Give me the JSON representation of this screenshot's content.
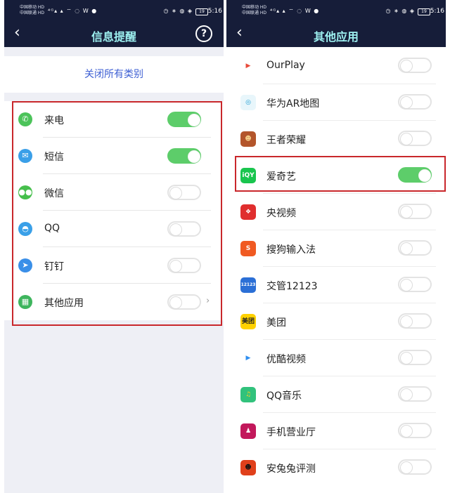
{
  "statusbar": {
    "carrier1": "中国移动 HD",
    "carrier2": "中国联通 HD",
    "left_icons": "⁴ᴳ▴ ▴ ⌔ ◌ W ●",
    "right_icons": "◷ ∗ ◍ ◈",
    "battery": "19",
    "time": "5:16"
  },
  "left": {
    "title": "信息提醒",
    "back_glyph": "‹",
    "help_glyph": "?",
    "close_all": "关闭所有类别",
    "chevron_glyph": "›",
    "categories": [
      {
        "label": "来电",
        "icon": "phone-icon",
        "glyph": "✆",
        "color": "#4cc35a",
        "on": true
      },
      {
        "label": "短信",
        "icon": "message-icon",
        "glyph": "✉",
        "color": "#3a9fe8",
        "on": true
      },
      {
        "label": "微信",
        "icon": "wechat-icon",
        "glyph": "●●",
        "color": "#46bf4c",
        "on": false
      },
      {
        "label": "QQ",
        "icon": "qq-icon",
        "glyph": "◓",
        "color": "#3aa0e8",
        "on": false
      },
      {
        "label": "钉钉",
        "icon": "dingtalk-icon",
        "glyph": "➤",
        "color": "#3a8fe8",
        "on": false
      },
      {
        "label": "其他应用",
        "icon": "apps-icon",
        "glyph": "▦",
        "color": "#3eb55d",
        "on": false,
        "has_chevron": true
      }
    ]
  },
  "right": {
    "title": "其他应用",
    "back_glyph": "‹",
    "apps": [
      {
        "label": "OurPlay",
        "icon": "ourplay-icon",
        "glyph": "▶",
        "color": "#ffffff",
        "fg": "#e84a3a",
        "on": false
      },
      {
        "label": "华为AR地图",
        "icon": "huawei-ar-map-icon",
        "glyph": "◎",
        "color": "#e8f6fb",
        "fg": "#1c9dd3",
        "on": false
      },
      {
        "label": "王者荣耀",
        "icon": "honor-of-kings-icon",
        "glyph": "☻",
        "color": "#b3552b",
        "fg": "#f5d08a",
        "on": false
      },
      {
        "label": "爱奇艺",
        "icon": "iqiyi-icon",
        "glyph": "iQY",
        "color": "#19c54e",
        "fg": "#ffffff",
        "on": true
      },
      {
        "label": "央视频",
        "icon": "cctv-video-icon",
        "glyph": "❖",
        "color": "#e02e2e",
        "fg": "#ffffff",
        "on": false
      },
      {
        "label": "搜狗输入法",
        "icon": "sogou-input-icon",
        "glyph": "S",
        "color": "#f05a22",
        "fg": "#ffffff",
        "on": false
      },
      {
        "label": "交管12123",
        "icon": "traffic-12123-icon",
        "glyph": "12123",
        "color": "#2b6fd6",
        "fg": "#ffffff",
        "on": false
      },
      {
        "label": "美团",
        "icon": "meituan-icon",
        "glyph": "美团",
        "color": "#ffd100",
        "fg": "#222222",
        "on": false
      },
      {
        "label": "优酷视频",
        "icon": "youku-icon",
        "glyph": "▶",
        "color": "#ffffff",
        "fg": "#2e8ef0",
        "on": false
      },
      {
        "label": "QQ音乐",
        "icon": "qq-music-icon",
        "glyph": "♫",
        "color": "#31c27c",
        "fg": "#ffd21e",
        "on": false
      },
      {
        "label": "手机营业厅",
        "icon": "mobile-hall-icon",
        "glyph": "♟",
        "color": "#c2185b",
        "fg": "#ffffff",
        "on": false
      },
      {
        "label": "安兔兔评测",
        "icon": "antutu-icon",
        "glyph": "☻",
        "color": "#e0401b",
        "fg": "#111111",
        "on": false
      }
    ]
  }
}
